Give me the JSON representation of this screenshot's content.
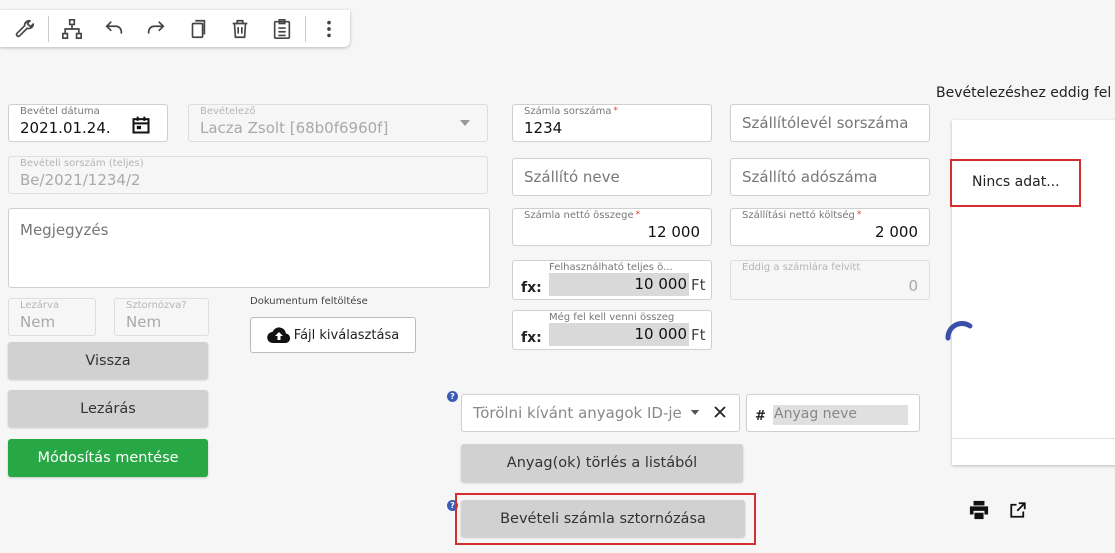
{
  "toolbar": {
    "icons": [
      "wrench-icon",
      "sitemap-icon",
      "undo-icon",
      "redo-icon",
      "copy-icon",
      "trash-icon",
      "clipboard-list-icon",
      "more-vert-icon"
    ]
  },
  "form": {
    "bevetel_datuma": {
      "label": "Bevétel dátuma",
      "value": "2021.01.24."
    },
    "bevetelezo": {
      "label": "Bevételező",
      "value": "Lacza Zsolt [68b0f6960f]"
    },
    "beveteli_sorszam": {
      "label": "Bevételi sorszám (teljes)",
      "value": "Be/2021/1234/2"
    },
    "megjegyzes": {
      "placeholder": "Megjegyzés"
    },
    "lezarva": {
      "label": "Lezárva",
      "value": "Nem"
    },
    "sztornozva": {
      "label": "Sztornózva?",
      "value": "Nem"
    },
    "dokumentum_label": "Dokumentum feltöltése",
    "fajl_button": "Fájl kiválasztása",
    "szamla_sorszama": {
      "label": "Számla sorszáma",
      "value": "1234"
    },
    "szallitolevel_sorszama": {
      "placeholder": "Szállítólevél sorszáma"
    },
    "szallito_neve": {
      "placeholder": "Szállító neve"
    },
    "szallito_adoszama": {
      "placeholder": "Szállító adószáma"
    },
    "szamla_netto": {
      "label": "Számla nettó összege",
      "value": "12 000"
    },
    "szallitasi_netto": {
      "label": "Szállítási nettó költség",
      "value": "2 000"
    },
    "felhasznalhato": {
      "label": "Felhasználható teljes ö...",
      "fx": "fx:",
      "value": "10 000",
      "unit": "Ft"
    },
    "eddig_felvitt": {
      "label": "Eddig a számlára felvitt",
      "value": "0"
    },
    "meg_fel_kell": {
      "label": "Még fel kell venni összeg",
      "fx": "fx:",
      "value": "10 000",
      "unit": "Ft"
    },
    "torolni_placeholder": "Törölni kívánt anyagok ID-je",
    "anyag_neve_placeholder": "Anyag neve",
    "hash": "#"
  },
  "buttons": {
    "vissza": "Vissza",
    "lezaras": "Lezárás",
    "modositas": "Módosítás mentése",
    "torles": "Anyag(ok) törlés a listából",
    "sztorno": "Bevételi számla sztornózása"
  },
  "right_panel": {
    "title": "Bevételezéshez eddig fel",
    "empty_text": "Nincs adat..."
  },
  "colors": {
    "primary_green": "#28a745",
    "highlight_red": "#d32f2f",
    "spinner_blue": "#3b4fa8"
  }
}
